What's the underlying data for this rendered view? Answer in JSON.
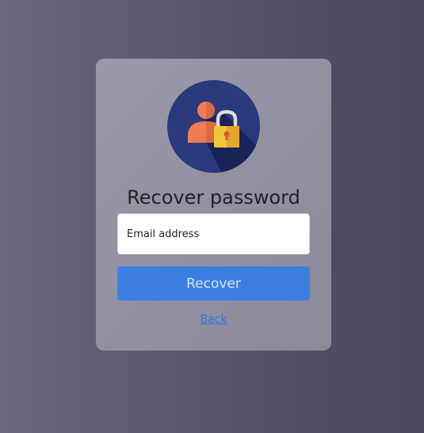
{
  "recover_form": {
    "title": "Recover password",
    "email_placeholder": "Email address",
    "submit_label": "Recover",
    "back_label": "Back"
  },
  "icons": {
    "avatar": "user-lock-icon"
  },
  "colors": {
    "submit_button": "#3d7ee3",
    "link": "#2f6fe0",
    "avatar_circle": "#2a3a7c"
  }
}
